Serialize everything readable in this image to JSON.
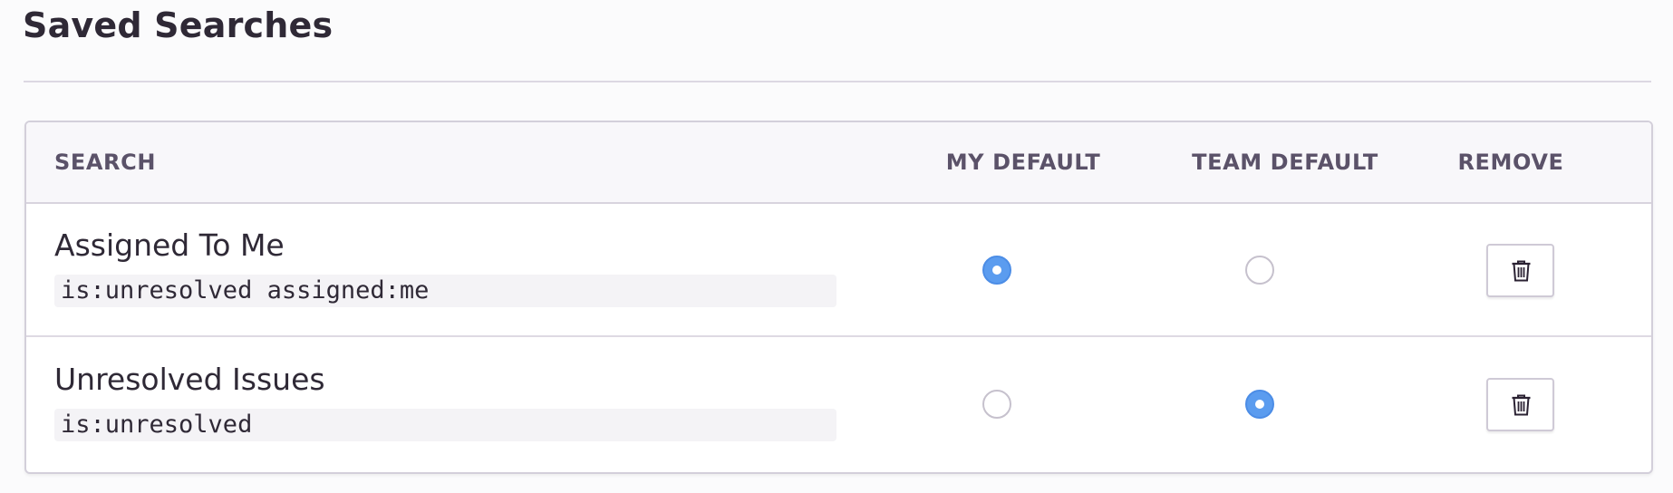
{
  "page": {
    "title": "Saved Searches"
  },
  "table": {
    "columns": {
      "search": "SEARCH",
      "my_default": "MY DEFAULT",
      "team_default": "TEAM DEFAULT",
      "remove": "REMOVE"
    },
    "rows": [
      {
        "name": "Assigned To Me",
        "query": "is:unresolved assigned:me",
        "my_default": true,
        "team_default": false,
        "remove_icon": "trash-icon"
      },
      {
        "name": "Unresolved Issues",
        "query": "is:unresolved",
        "my_default": false,
        "team_default": true,
        "remove_icon": "trash-icon"
      }
    ]
  },
  "colors": {
    "radio_selected": "#5b9cef",
    "header_text": "#5b5269",
    "title_text": "#2f2936"
  }
}
